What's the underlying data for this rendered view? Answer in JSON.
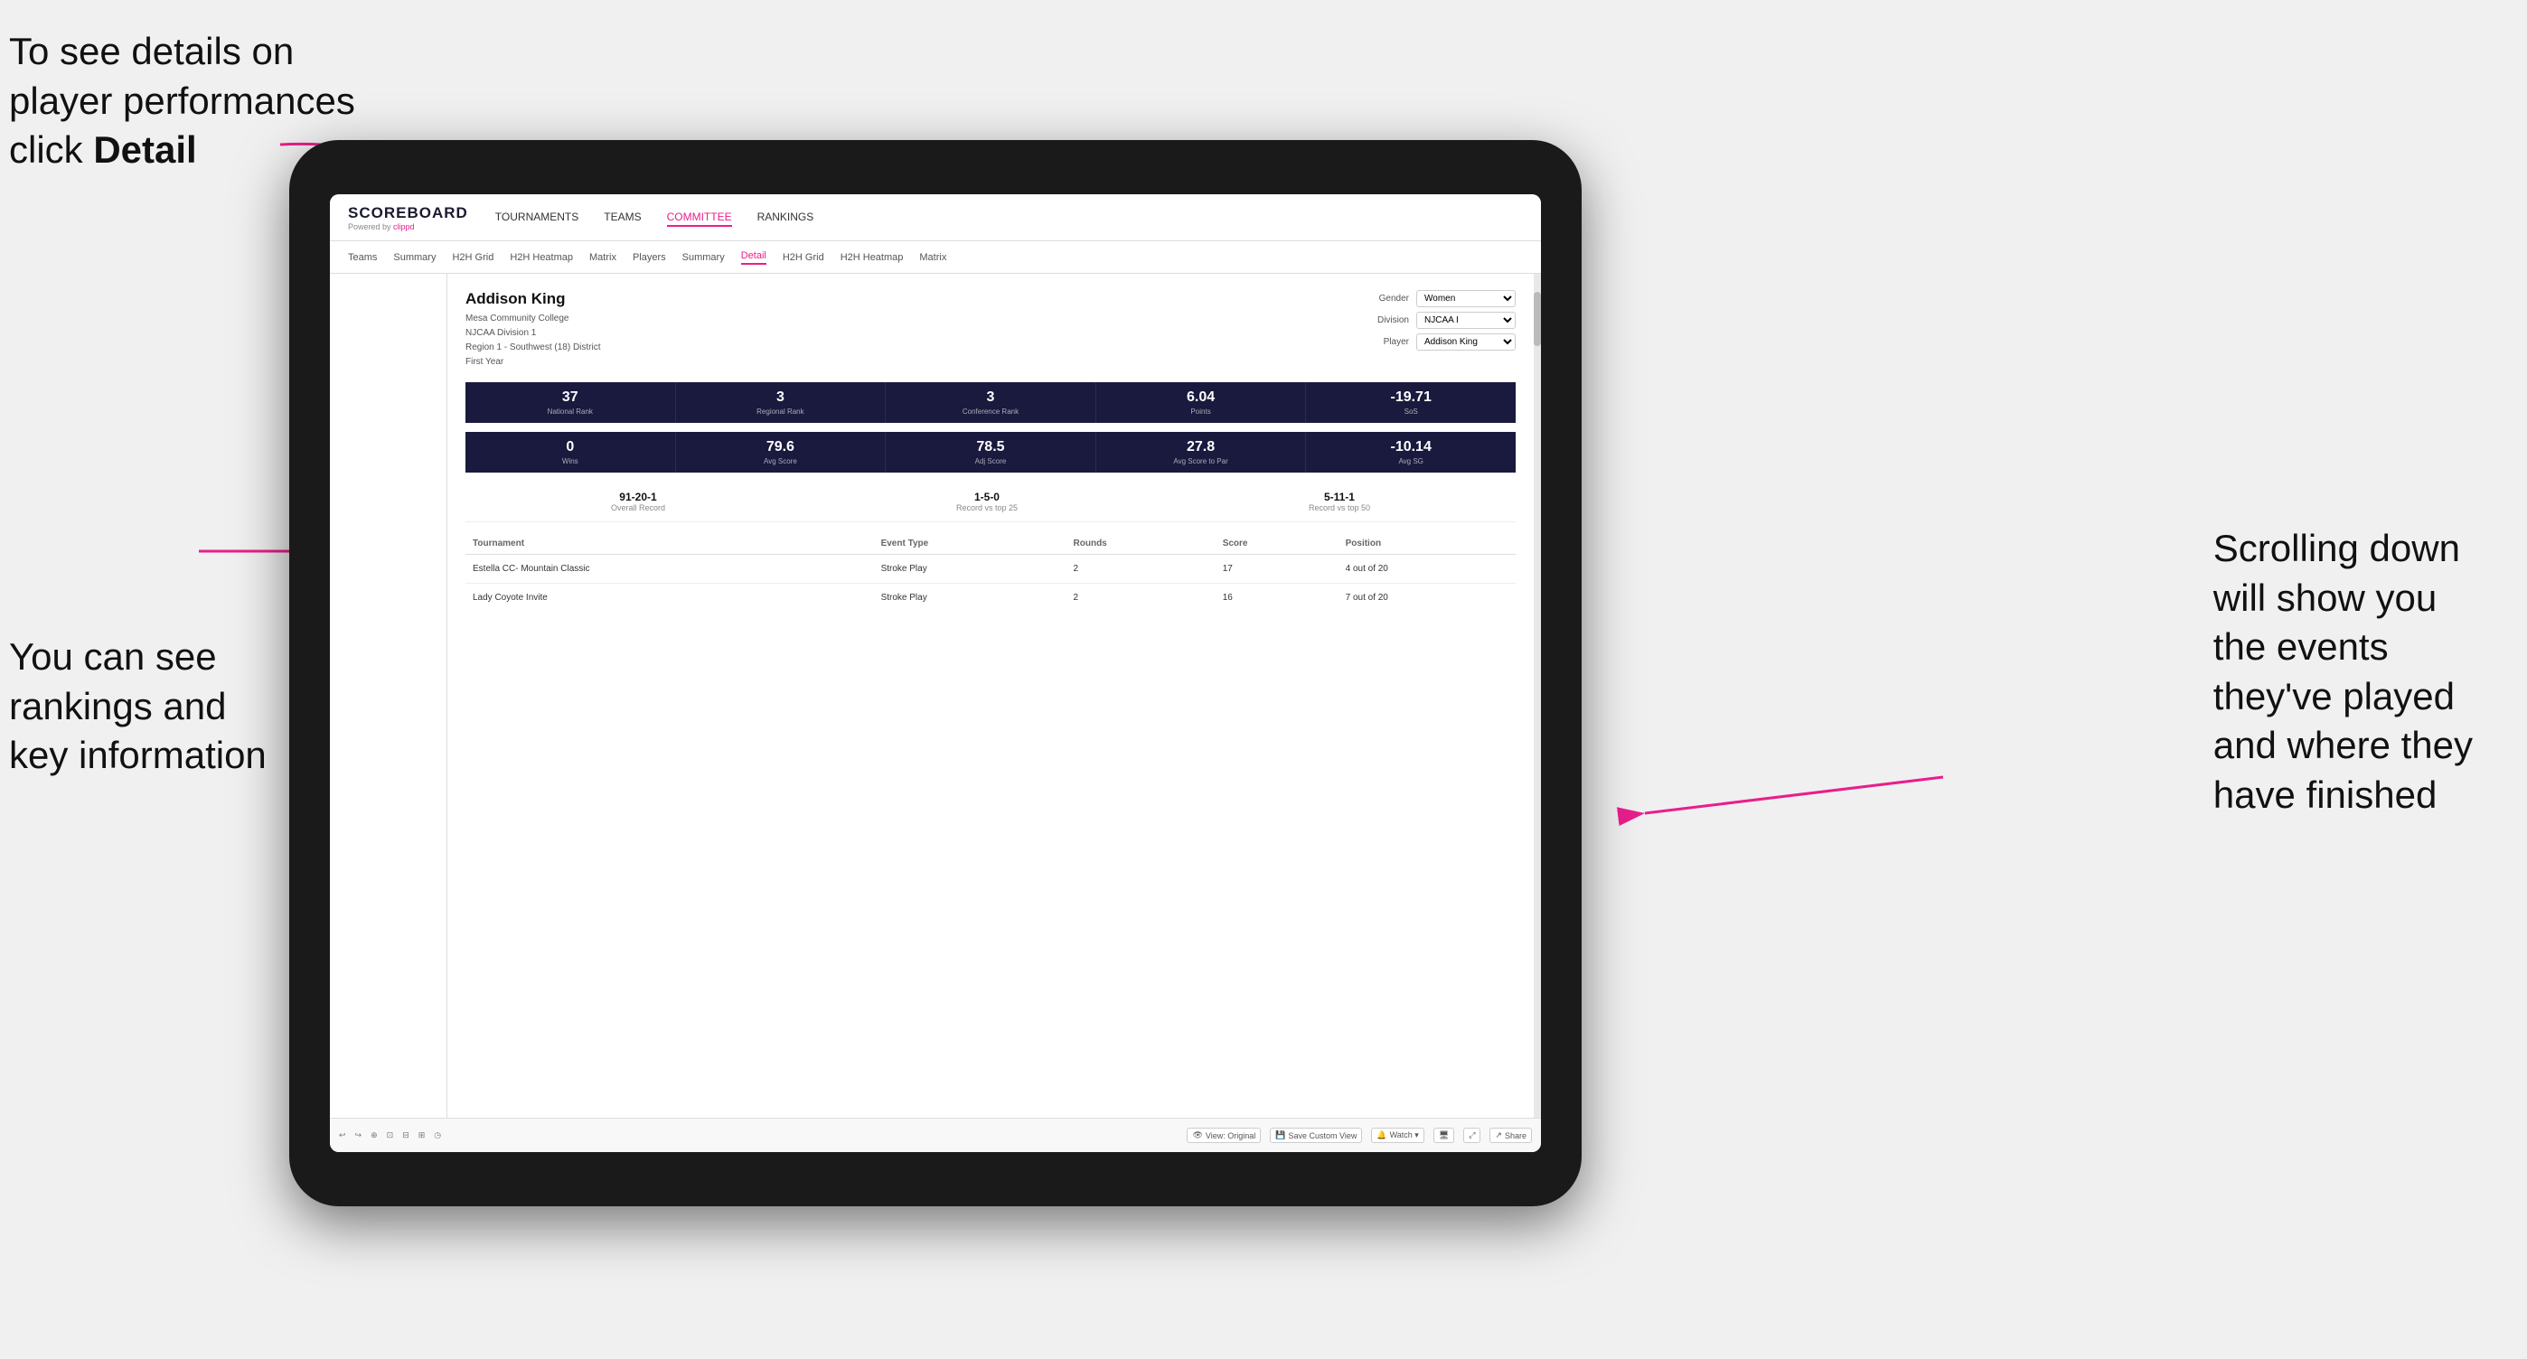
{
  "annotations": {
    "top_left_line1": "To see details on",
    "top_left_line2": "player performances",
    "top_left_line3": "click ",
    "top_left_bold": "Detail",
    "bottom_left_line1": "You can see",
    "bottom_left_line2": "rankings and",
    "bottom_left_line3": "key information",
    "right_line1": "Scrolling down",
    "right_line2": "will show you",
    "right_line3": "the events",
    "right_line4": "they've played",
    "right_line5": "and where they",
    "right_line6": "have finished"
  },
  "nav": {
    "logo": "SCOREBOARD",
    "powered": "Powered by ",
    "clippd": "clippd",
    "links": [
      "TOURNAMENTS",
      "TEAMS",
      "COMMITTEE",
      "RANKINGS"
    ]
  },
  "subnav": {
    "items": [
      "Teams",
      "Summary",
      "H2H Grid",
      "H2H Heatmap",
      "Matrix",
      "Players",
      "Summary",
      "Detail",
      "H2H Grid",
      "H2H Heatmap",
      "Matrix"
    ],
    "active": "Detail"
  },
  "player": {
    "name": "Addison King",
    "college": "Mesa Community College",
    "division": "NJCAA Division 1",
    "region": "Region 1 - Southwest (18) District",
    "year": "First Year"
  },
  "filters": {
    "gender_label": "Gender",
    "gender_value": "Women",
    "division_label": "Division",
    "division_value": "NJCAA I",
    "player_label": "Player",
    "player_value": "Addison King"
  },
  "stats_row1": [
    {
      "value": "37",
      "label": "National Rank"
    },
    {
      "value": "3",
      "label": "Regional Rank"
    },
    {
      "value": "3",
      "label": "Conference Rank"
    },
    {
      "value": "6.04",
      "label": "Points"
    },
    {
      "value": "-19.71",
      "label": "SoS"
    }
  ],
  "stats_row2": [
    {
      "value": "0",
      "label": "Wins"
    },
    {
      "value": "79.6",
      "label": "Avg Score"
    },
    {
      "value": "78.5",
      "label": "Adj Score"
    },
    {
      "value": "27.8",
      "label": "Avg Score to Par"
    },
    {
      "value": "-10.14",
      "label": "Avg SG"
    }
  ],
  "records": [
    {
      "value": "91-20-1",
      "label": "Overall Record"
    },
    {
      "value": "1-5-0",
      "label": "Record vs top 25"
    },
    {
      "value": "5-11-1",
      "label": "Record vs top 50"
    }
  ],
  "table": {
    "headers": [
      "Tournament",
      "Event Type",
      "Rounds",
      "Score",
      "Position"
    ],
    "rows": [
      {
        "tournament": "Estella CC- Mountain Classic",
        "event_type": "Stroke Play",
        "rounds": "2",
        "score": "17",
        "position": "4 out of 20"
      },
      {
        "tournament": "Lady Coyote Invite",
        "event_type": "Stroke Play",
        "rounds": "2",
        "score": "16",
        "position": "7 out of 20"
      }
    ]
  },
  "toolbar": {
    "undo": "↩",
    "redo": "↪",
    "buttons": [
      "View: Original",
      "Save Custom View",
      "Watch ▾",
      "Share"
    ]
  }
}
